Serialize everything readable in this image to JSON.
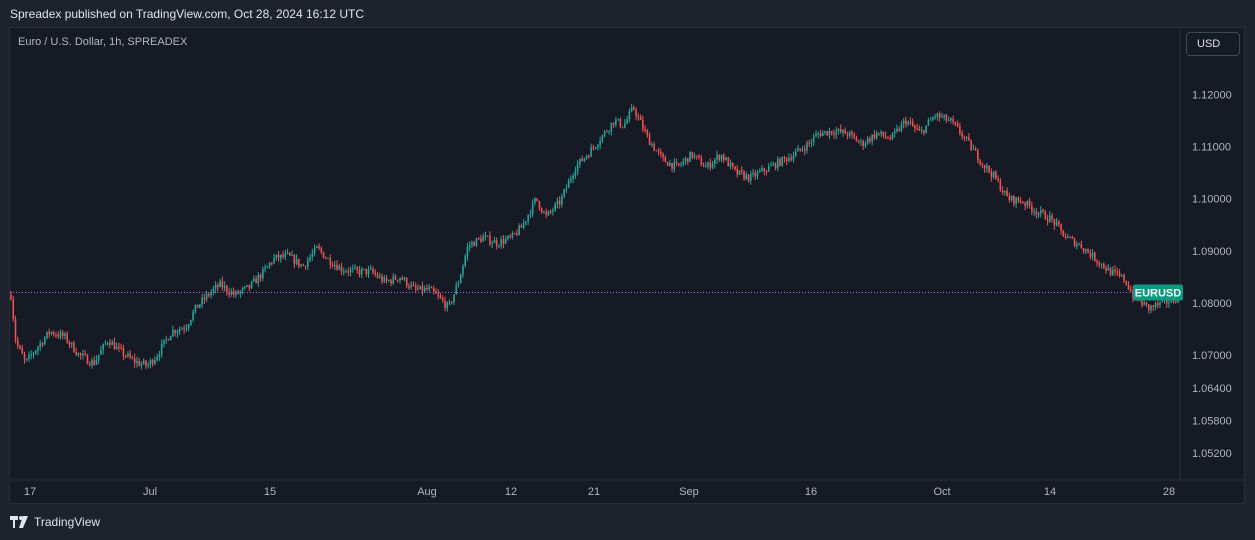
{
  "caption": "Spreadex published on TradingView.com, Oct 28, 2024 16:12 UTC",
  "symbol_title": "Euro / U.S. Dollar, 1h, SPREADEX",
  "currency_button": "USD",
  "footer_brand": "TradingView",
  "footer_icon": "tradingview-logo-icon",
  "colors": {
    "up": "#26a69a",
    "down": "#ef5350",
    "label_bg": "#089981",
    "price_line": "#9c6ade"
  },
  "chart_data": {
    "type": "candlestick",
    "symbol": "EURUSD",
    "last_price": 1.082,
    "price_line_label": "EURUSD",
    "y_ticks": [
      "1.12000",
      "1.11000",
      "1.10000",
      "1.09000",
      "1.08000",
      "1.07000",
      "1.06400",
      "1.05800",
      "1.05200"
    ],
    "x_ticks": [
      "17",
      "Jul",
      "15",
      "Aug",
      "12",
      "21",
      "Sep",
      "16",
      "Oct",
      "14",
      "28"
    ],
    "path": [
      [
        0,
        1.0815
      ],
      [
        1,
        1.0725
      ],
      [
        3,
        1.0685
      ],
      [
        5,
        1.071
      ],
      [
        8,
        1.0745
      ],
      [
        11,
        1.0735
      ],
      [
        14,
        1.07
      ],
      [
        17,
        1.0685
      ],
      [
        20,
        1.073
      ],
      [
        22,
        1.071
      ],
      [
        25,
        1.069
      ],
      [
        28,
        1.068
      ],
      [
        30,
        1.07
      ],
      [
        33,
        1.0745
      ],
      [
        36,
        1.0755
      ],
      [
        38,
        1.079
      ],
      [
        41,
        1.082
      ],
      [
        43,
        1.0835
      ],
      [
        46,
        1.0815
      ],
      [
        49,
        1.083
      ],
      [
        52,
        1.086
      ],
      [
        54,
        1.0885
      ],
      [
        57,
        1.089
      ],
      [
        60,
        1.087
      ],
      [
        63,
        1.0905
      ],
      [
        65,
        1.0885
      ],
      [
        68,
        1.0865
      ],
      [
        71,
        1.086
      ],
      [
        74,
        1.086
      ],
      [
        77,
        1.084
      ],
      [
        80,
        1.085
      ],
      [
        83,
        1.0825
      ],
      [
        86,
        1.0825
      ],
      [
        88,
        1.081
      ],
      [
        90,
        1.079
      ],
      [
        92,
        1.084
      ],
      [
        94,
        1.091
      ],
      [
        97,
        1.0925
      ],
      [
        100,
        1.0915
      ],
      [
        103,
        1.0925
      ],
      [
        105,
        1.0945
      ],
      [
        108,
        1.1
      ],
      [
        110,
        1.0965
      ],
      [
        113,
        1.0995
      ],
      [
        116,
        1.106
      ],
      [
        119,
        1.109
      ],
      [
        122,
        1.1125
      ],
      [
        124,
        1.115
      ],
      [
        126,
        1.114
      ],
      [
        128,
        1.1175
      ],
      [
        131,
        1.1115
      ],
      [
        134,
        1.1075
      ],
      [
        137,
        1.106
      ],
      [
        140,
        1.1085
      ],
      [
        143,
        1.106
      ],
      [
        146,
        1.1085
      ],
      [
        149,
        1.105
      ],
      [
        152,
        1.104
      ],
      [
        155,
        1.1055
      ],
      [
        158,
        1.107
      ],
      [
        161,
        1.1085
      ],
      [
        164,
        1.1105
      ],
      [
        166,
        1.1125
      ],
      [
        169,
        1.113
      ],
      [
        172,
        1.1125
      ],
      [
        175,
        1.1105
      ],
      [
        178,
        1.1125
      ],
      [
        181,
        1.1115
      ],
      [
        184,
        1.115
      ],
      [
        187,
        1.1125
      ],
      [
        190,
        1.116
      ],
      [
        193,
        1.115
      ],
      [
        195,
        1.113
      ],
      [
        197,
        1.1105
      ],
      [
        200,
        1.1065
      ],
      [
        202,
        1.1045
      ],
      [
        205,
        1.1
      ],
      [
        208,
        1.0995
      ],
      [
        211,
        1.0975
      ],
      [
        214,
        1.096
      ],
      [
        217,
        1.0925
      ],
      [
        220,
        1.091
      ],
      [
        223,
        1.0885
      ],
      [
        226,
        1.086
      ],
      [
        229,
        1.0845
      ],
      [
        231,
        1.081
      ],
      [
        234,
        1.079
      ],
      [
        237,
        1.08
      ],
      [
        240,
        1.081
      ]
    ]
  }
}
